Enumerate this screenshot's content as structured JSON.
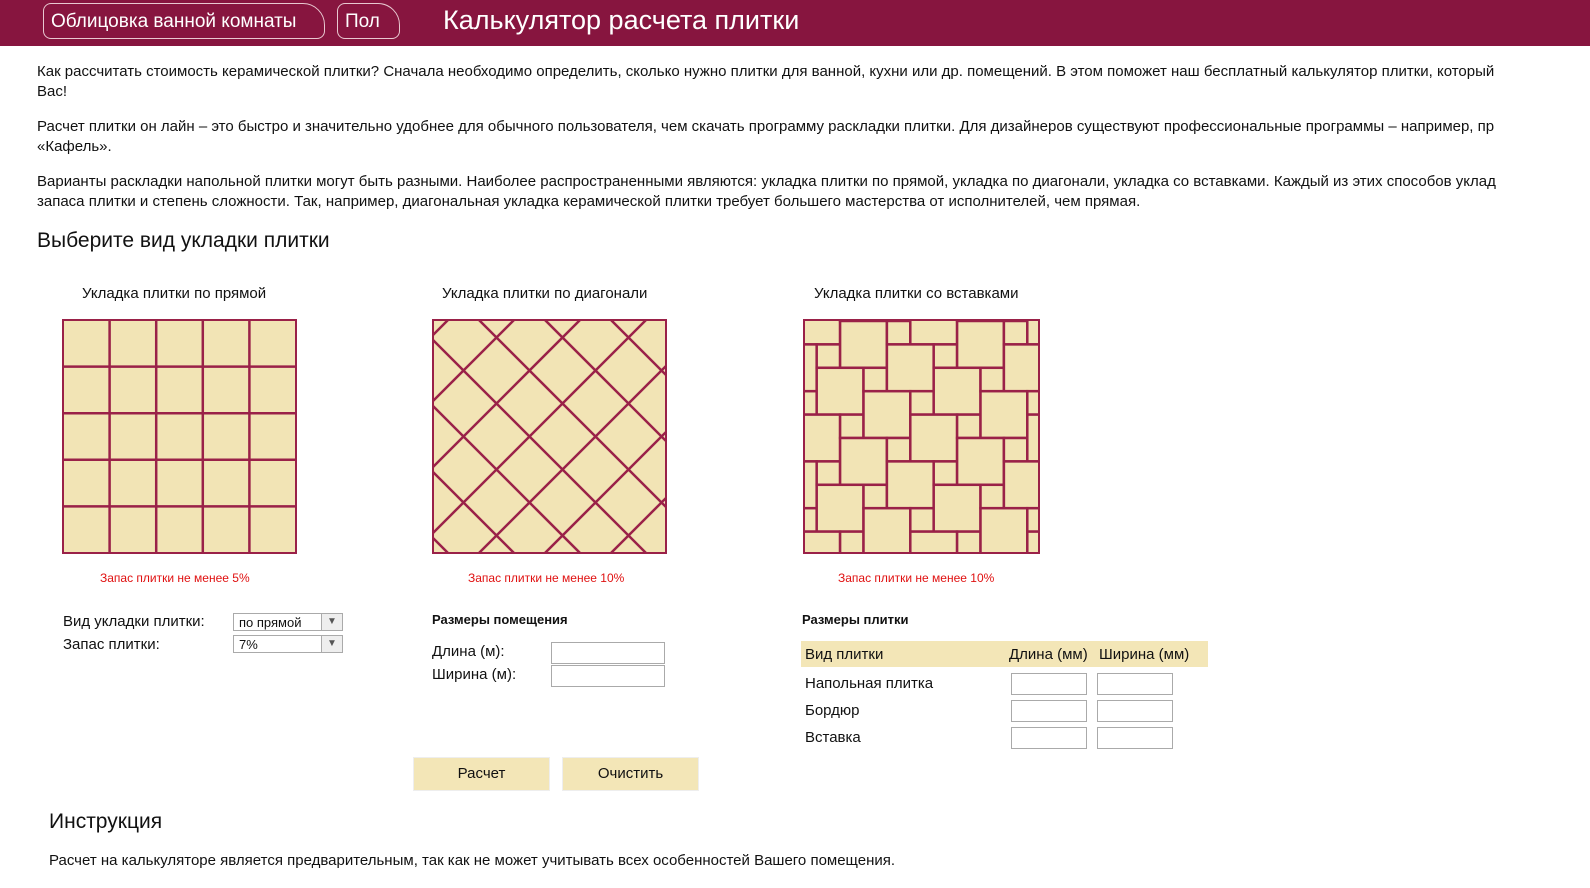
{
  "header": {
    "tabs": [
      "Облицовка ванной комнаты",
      "Пол"
    ],
    "title": "Калькулятор расчета плитки",
    "color": "#87153f"
  },
  "intro": [
    "Как рассчитать стоимость керамической плитки? Сначала необходимо определить, сколько нужно плитки для ванной, кухни или др. помещений. В этом поможет наш бесплатный калькулятор плитки, который",
    "Вас!",
    "Расчет плитки он лайн – это быстро и значительно удобнее для обычного пользователя, чем скачать программу раскладки плитки. Для дизайнеров существуют профессиональные программы – например, пр",
    "«Кафель».",
    "Варианты раскладки напольной плитки могут быть разными. Наиболее распространенными являются: укладка плитки по прямой, укладка по диагонали, укладка со вставками. Каждый из этих способов уклад",
    "запаса плитки и степень сложности. Так, например, диагональная укладка керамической плитки требует большего мастерства от исполнителей, чем прямая."
  ],
  "choose_title": "Выберите вид укладки плитки",
  "layouts": [
    {
      "name": "Укладка плитки по прямой",
      "reserve": "Запас плитки не менее 5%",
      "icon": "straight-tile-pattern"
    },
    {
      "name": "Укладка плитки по диагонали",
      "reserve": "Запас плитки не менее 10%",
      "icon": "diagonal-tile-pattern"
    },
    {
      "name": "Укладка плитки со вставками",
      "reserve": "Запас плитки не менее 10%",
      "icon": "inserts-tile-pattern"
    }
  ],
  "colors": {
    "tile": "#f2e4b5",
    "grout": "#9a2148",
    "accent": "#f3e6b7",
    "warning": "#e01010"
  },
  "form": {
    "layout_label": "Вид укладки плитки:",
    "layout_value": "по прямой",
    "reserve_label": "Запас плитки:",
    "reserve_value": "7%",
    "room_title": "Размеры помещения",
    "room_length": "Длина (м):",
    "room_width": "Ширина (м):",
    "tile_title": "Размеры плитки",
    "tile_headers": [
      "Вид плитки",
      "Длина (мм)",
      "Ширина (мм)"
    ],
    "tile_rows": [
      "Напольная плитка",
      "Бордюр",
      "Вставка"
    ],
    "calc": "Расчет",
    "clear": "Очистить"
  },
  "instr": {
    "title": "Инструкция",
    "text": "Расчет на калькуляторе является предварительным, так как не может учитывать всех особенностей Вашего помещения."
  }
}
